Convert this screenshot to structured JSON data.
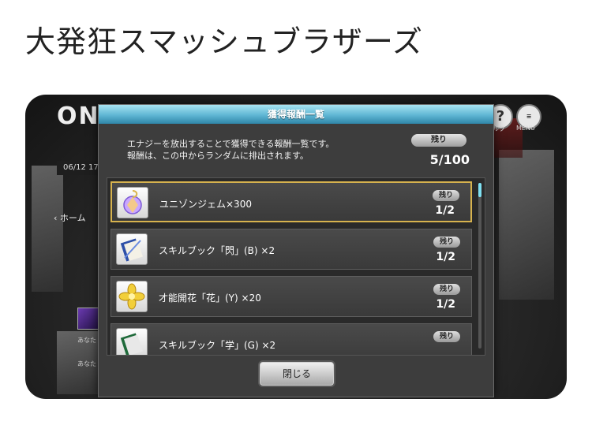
{
  "page": {
    "title": "大発狂スマッシュブラザーズ"
  },
  "background": {
    "logo_text": "ON",
    "date_text": "06/12 17",
    "home_label": "ホーム",
    "help_label": "ヘルプ",
    "menu_label": "MENU",
    "side_text_1": "あなた\n累計",
    "side_text_2": "あなた\n貢献"
  },
  "modal": {
    "title": "獲得報酬一覧",
    "description_line1": "エナジーを放出することで獲得できる報酬一覧です。",
    "description_line2": "報酬は、この中からランダムに排出されます。",
    "remain_label": "残り",
    "remain_count": "5/100",
    "close_label": "閉じる",
    "rewards": [
      {
        "name": "ユニゾンジェム×300",
        "remain_label": "残り",
        "count": "1/2",
        "icon": "unison-gem-icon",
        "selected": true
      },
      {
        "name": "スキルブック「閃」(B) ×2",
        "remain_label": "残り",
        "count": "1/2",
        "icon": "skill-book-icon",
        "selected": false
      },
      {
        "name": "才能開花「花」(Y) ×20",
        "remain_label": "残り",
        "count": "1/2",
        "icon": "talent-flower-icon",
        "selected": false
      },
      {
        "name": "スキルブック「学」(G) ×2",
        "remain_label": "残り",
        "count": "",
        "icon": "skill-book-icon",
        "selected": false
      }
    ]
  },
  "colors": {
    "header_accent": "#5fb6d3",
    "selected_border": "#d6b24e",
    "scroll_thumb": "#7fe0f2"
  }
}
